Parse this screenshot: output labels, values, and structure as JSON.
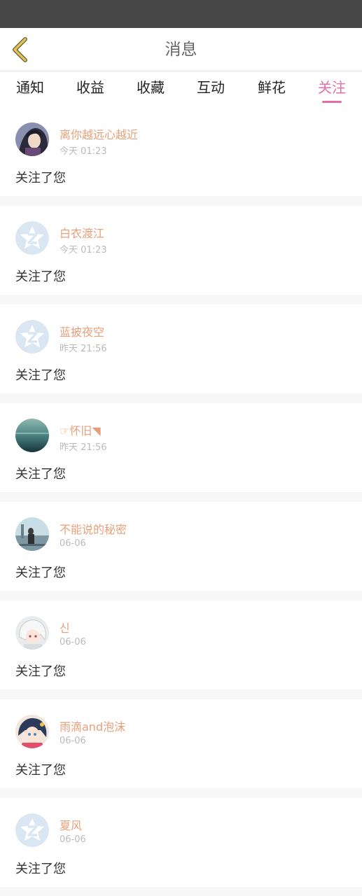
{
  "header": {
    "title": "消息",
    "back_icon": "chevron-left-icon",
    "accent_back": "#e7c25a"
  },
  "tabs": [
    {
      "label": "通知",
      "active": false
    },
    {
      "label": "收益",
      "active": false
    },
    {
      "label": "收藏",
      "active": false
    },
    {
      "label": "互动",
      "active": false
    },
    {
      "label": "鲜花",
      "active": false
    },
    {
      "label": "关注",
      "active": true
    }
  ],
  "colors": {
    "accent": "#e36fa6",
    "username": "#e8a07a",
    "timestamp": "#bbbbbb"
  },
  "notifications": [
    {
      "username": "离你越远心越近",
      "time": "今天 01:23",
      "message": "关注了您",
      "avatar": "anime-avatar-dark"
    },
    {
      "username": "白衣渡江",
      "time": "今天 01:23",
      "message": "关注了您",
      "avatar": "default-z-avatar"
    },
    {
      "username": "蓝披夜空",
      "time": "昨天 21:56",
      "message": "关注了您",
      "avatar": "default-z-avatar"
    },
    {
      "username": "☞怀旧◥",
      "time": "昨天 21:56",
      "message": "关注了您",
      "avatar": "sea-avatar"
    },
    {
      "username": "不能说的秘密",
      "time": "06-06",
      "message": "关注了您",
      "avatar": "photo-avatar-person"
    },
    {
      "username": "신",
      "time": "06-06",
      "message": "关注了您",
      "avatar": "anime-avatar-white"
    },
    {
      "username": "雨滴and泡沫",
      "time": "06-06",
      "message": "关注了您",
      "avatar": "anime-avatar-colorful"
    },
    {
      "username": "夏风",
      "time": "06-06",
      "message": "关注了您",
      "avatar": "default-z-avatar"
    }
  ]
}
